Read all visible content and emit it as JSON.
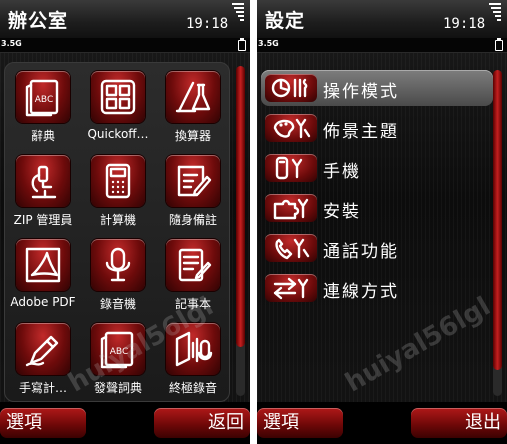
{
  "left": {
    "title": "辦公室",
    "clock": "19:18",
    "network": "3.5G",
    "apps": [
      {
        "label": "辭典",
        "icon": "dictionary-abc-icon"
      },
      {
        "label": "Quickoff…",
        "icon": "quickoffice-icon"
      },
      {
        "label": "換算器",
        "icon": "converter-icon"
      },
      {
        "label": "ZIP 管理員",
        "icon": "zip-microscope-icon"
      },
      {
        "label": "計算機",
        "icon": "calculator-icon"
      },
      {
        "label": "隨身備註",
        "icon": "notes-pen-icon"
      },
      {
        "label": "Adobe PDF",
        "icon": "adobe-pdf-icon"
      },
      {
        "label": "錄音機",
        "icon": "microphone-icon"
      },
      {
        "label": "記事本",
        "icon": "notepad-icon"
      },
      {
        "label": "手寫計…",
        "icon": "handwriting-pen-icon"
      },
      {
        "label": "發聲詞典",
        "icon": "talking-dictionary-icon"
      },
      {
        "label": "終極錄音",
        "icon": "ultimate-recorder-icon"
      }
    ],
    "dict_glyph": "ABC",
    "softkeys": {
      "left": "選項",
      "right": "返回"
    },
    "scroll_position": 0.0,
    "scroll_visible_fraction": 0.85
  },
  "right": {
    "title": "設定",
    "clock": "19:18",
    "network": "3.5G",
    "items": [
      {
        "label": "操作模式",
        "icon": "profile-tools-icon",
        "selected": true
      },
      {
        "label": "佈景主題",
        "icon": "palette-tools-icon",
        "selected": false
      },
      {
        "label": "手機",
        "icon": "phone-tools-icon",
        "selected": false
      },
      {
        "label": "安裝",
        "icon": "puzzle-install-icon",
        "selected": false
      },
      {
        "label": "通話功能",
        "icon": "call-settings-icon",
        "selected": false
      },
      {
        "label": "連線方式",
        "icon": "connectivity-arrows-icon",
        "selected": false
      }
    ],
    "softkeys": {
      "left": "選項",
      "right": "退出"
    },
    "scroll_position": 0.0,
    "scroll_visible_fraction": 0.92
  },
  "watermark": "huiyal56lgl",
  "colors": {
    "accent": "#a01414",
    "accent_dark": "#3b0202",
    "background": "#111111",
    "text": "#ffffff"
  }
}
